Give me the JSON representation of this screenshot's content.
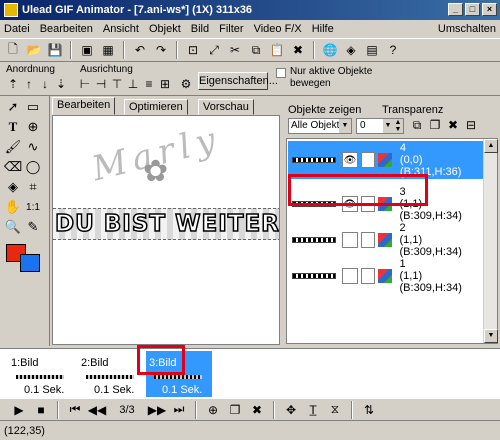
{
  "window": {
    "title": "Ulead GIF Animator - [7.ani-ws*] (1X) 311x36"
  },
  "menu": {
    "items": [
      "Datei",
      "Bearbeiten",
      "Ansicht",
      "Objekt",
      "Bild",
      "Filter",
      "Video F/X",
      "Hilfe"
    ],
    "right": "Umschalten"
  },
  "arrange": {
    "anordnung_label": "Anordnung",
    "ausrichtung_label": "Ausrichtung",
    "eigenschaften_label": "Eigenschaften...",
    "only_active_label": "Nur aktive Objekte bewegen",
    "only_active_checked": false
  },
  "tabs": [
    "Bearbeiten",
    "Optimieren",
    "Vorschau"
  ],
  "canvas": {
    "watermark": "Marly",
    "banner_text": "DU BIST WEITER"
  },
  "objects_panel": {
    "show_label": "Objekte zeigen",
    "show_value": "Alle Objekte",
    "transparency_label": "Transparenz",
    "transparency_value": "0",
    "rows": [
      {
        "num": "4",
        "coords": "(0,0)(B:311,H:36)",
        "selected": true,
        "visible": true
      },
      {
        "num": "3",
        "coords": "(1,1)(B:309,H:34)",
        "selected": false,
        "visible": true
      },
      {
        "num": "2",
        "coords": "(1,1)(B:309,H:34)",
        "selected": false,
        "visible": false
      },
      {
        "num": "1",
        "coords": "(1,1)(B:309,H:34)",
        "selected": false,
        "visible": false
      }
    ]
  },
  "frames": [
    {
      "name": "1:Bild",
      "delay": "0.1 Sek.",
      "selected": false
    },
    {
      "name": "2:Bild",
      "delay": "0.1 Sek.",
      "selected": false
    },
    {
      "name": "3:Bild",
      "delay": "0.1 Sek.",
      "selected": true
    }
  ],
  "playback": {
    "counter": "3/3"
  },
  "status": {
    "coords": "(122,35)"
  },
  "colors": {
    "foreground": "#e8280f",
    "background": "#1a74f0",
    "selection": "#3399ff",
    "highlight_box": "#e0001a"
  }
}
